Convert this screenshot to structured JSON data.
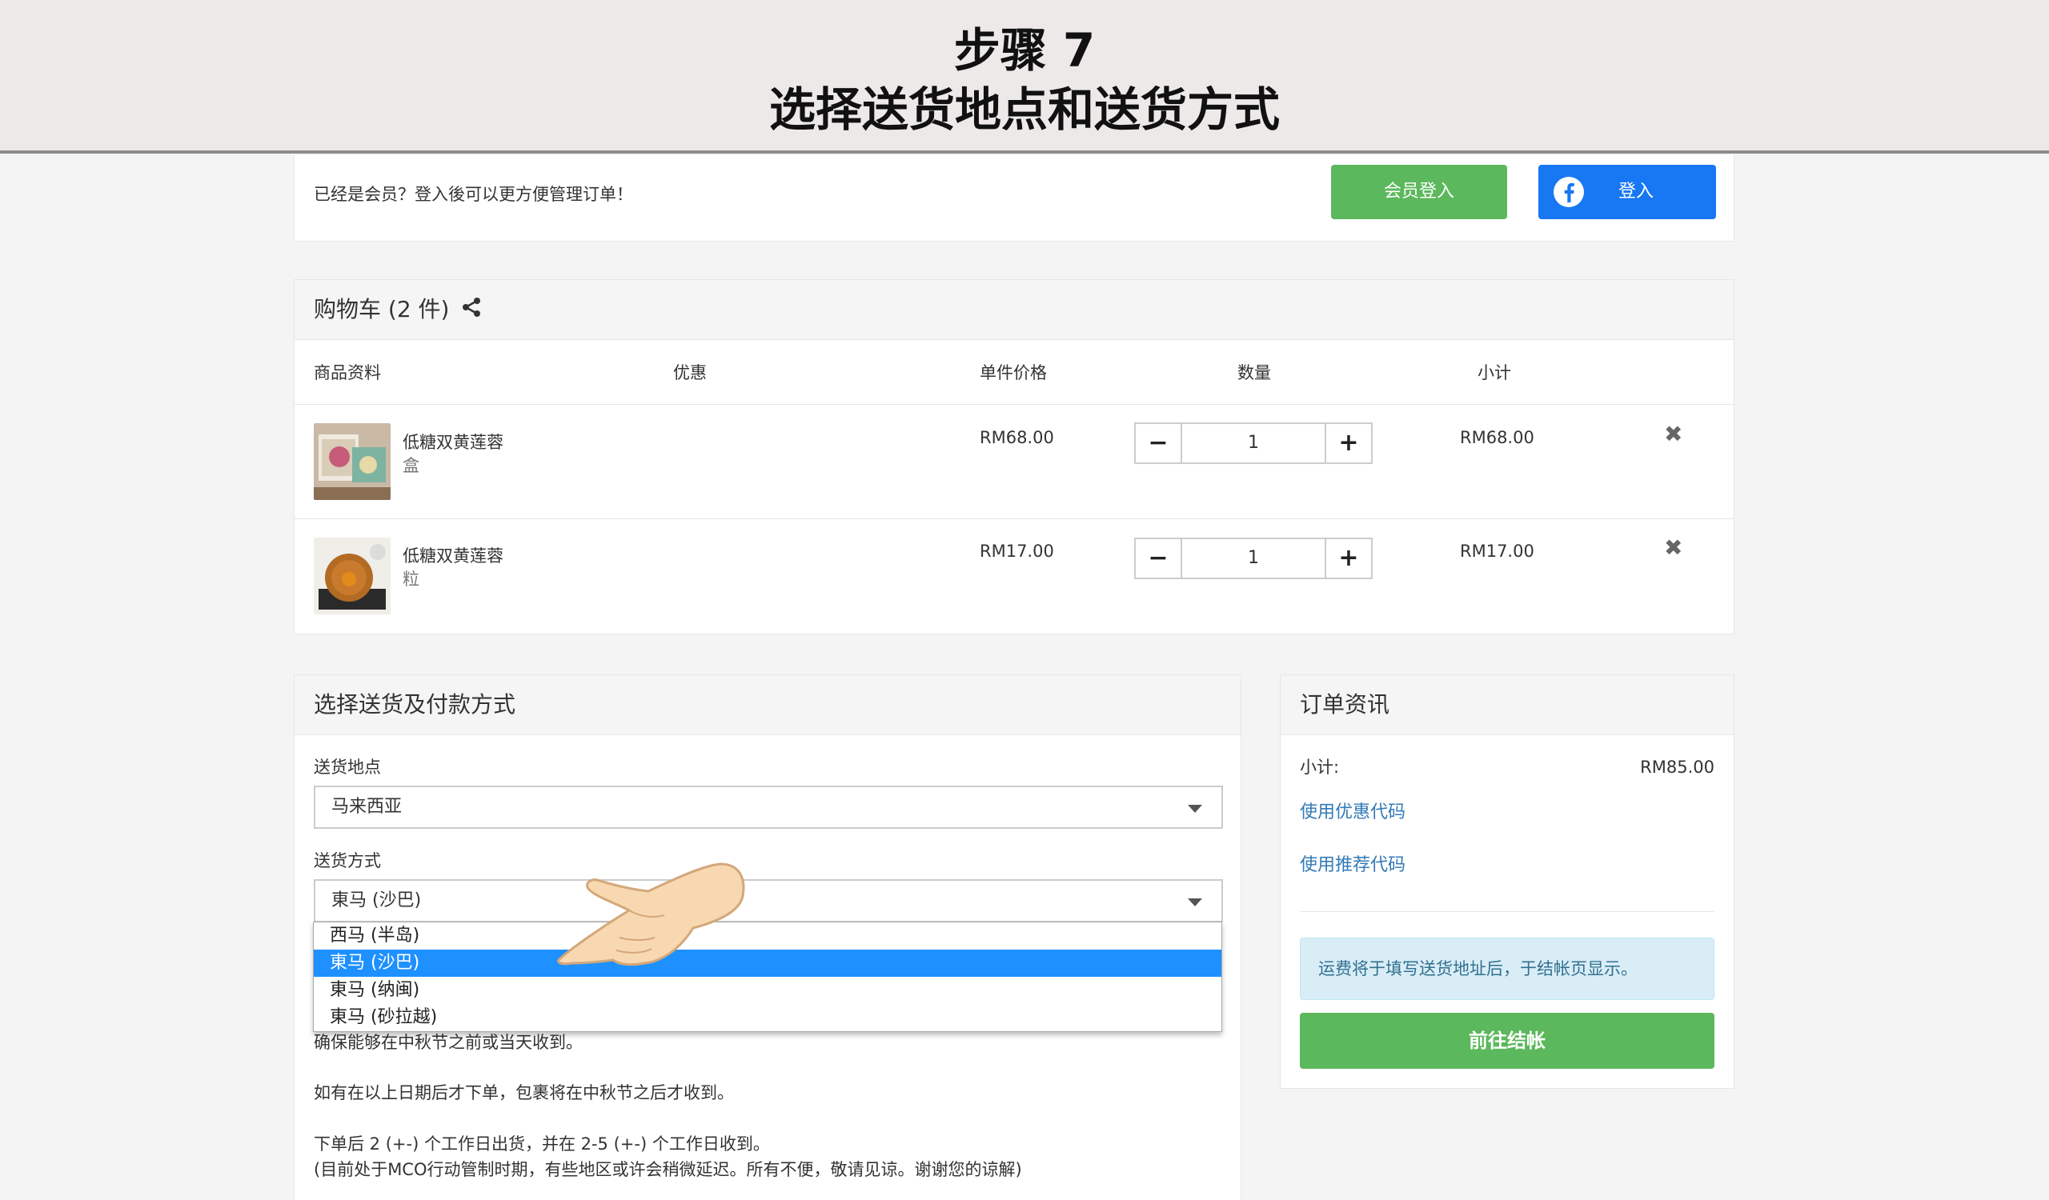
{
  "banner": {
    "line1": "步骤 7",
    "line2": "选择送货地点和送货方式"
  },
  "member": {
    "prompt": "已经是会员？登入後可以更方便管理订单！",
    "login_button": "会员登入",
    "fb_login_button": "登入",
    "colors": {
      "green": "#5cb85c",
      "facebook": "#1877f2"
    }
  },
  "cart": {
    "title": "购物车 (2 件)",
    "columns": [
      "商品资料",
      "优惠",
      "单件价格",
      "数量",
      "小计"
    ],
    "items": [
      {
        "name": "低糖双黄莲蓉",
        "unit": "盒",
        "price": "RM68.00",
        "qty": "1",
        "subtotal": "RM68.00"
      },
      {
        "name": "低糖双黄莲蓉",
        "unit": "粒",
        "price": "RM17.00",
        "qty": "1",
        "subtotal": "RM17.00"
      }
    ]
  },
  "shipping": {
    "title": "选择送货及付款方式",
    "location_label": "送货地点",
    "location_value": "马来西亚",
    "method_label": "送货方式",
    "method_value": "東马 (沙巴)",
    "options": [
      "西马 (半岛)",
      "東马 (沙巴)",
      "東马 (纳闽)",
      "東马 (砂拉越)"
    ],
    "selected_index": 1,
    "note1": "确保能够在中秋节之前或当天收到。",
    "note2": "如有在以上日期后才下单，包裹将在中秋节之后才收到。",
    "note3": "下单后 2 (+-) 个工作日出货，并在 2-5 (+-) 个工作日收到。",
    "note4": "(目前处于MCO行动管制时期，有些地区或许会稍微延迟。所有不便，敬请见谅。谢谢您的谅解)"
  },
  "order": {
    "title": "订单资讯",
    "subtotal_label": "小计:",
    "subtotal_value": "RM85.00",
    "coupon_link": "使用优惠代码",
    "referral_link": "使用推荐代码",
    "shipping_notice": "运费将于填写送货地址后，于结帐页显示。",
    "checkout_button": "前往结帐"
  }
}
